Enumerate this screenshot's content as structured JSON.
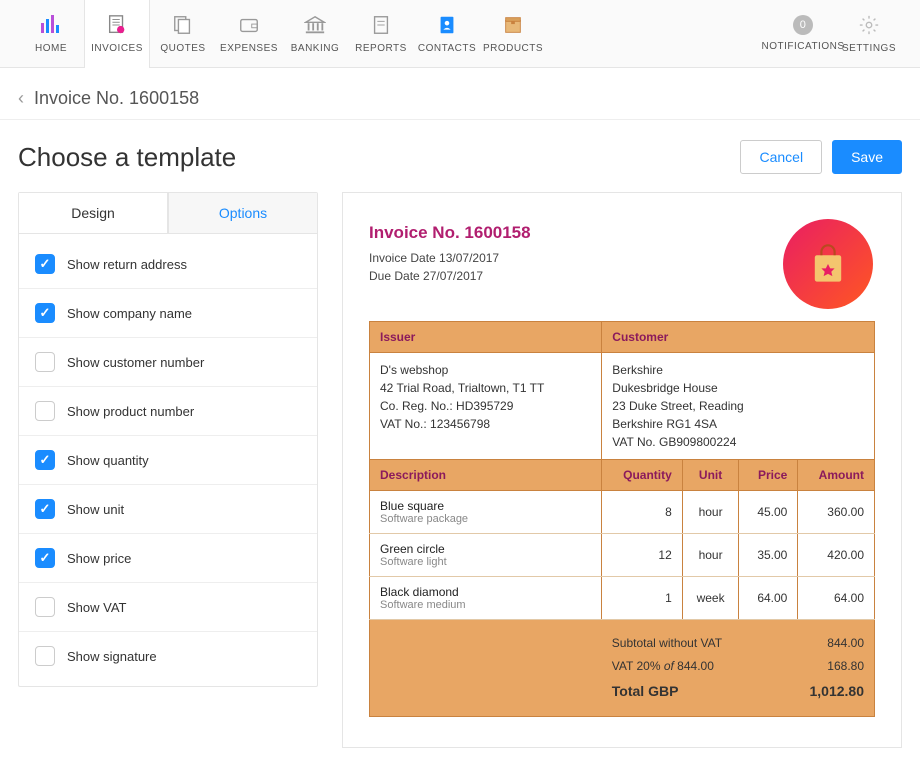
{
  "nav": {
    "items": [
      {
        "label": "HOME"
      },
      {
        "label": "INVOICES"
      },
      {
        "label": "QUOTES"
      },
      {
        "label": "EXPENSES"
      },
      {
        "label": "BANKING"
      },
      {
        "label": "REPORTS"
      },
      {
        "label": "CONTACTS"
      },
      {
        "label": "PRODUCTS"
      }
    ],
    "notifications_label": "NOTIFICATIONS",
    "notifications_count": "0",
    "settings_label": "SETTINGS"
  },
  "breadcrumb": "Invoice No. 1600158",
  "page_title": "Choose a template",
  "buttons": {
    "cancel": "Cancel",
    "save": "Save"
  },
  "tabs": {
    "design": "Design",
    "options": "Options"
  },
  "options": [
    {
      "label": "Show return address",
      "checked": true
    },
    {
      "label": "Show company name",
      "checked": true
    },
    {
      "label": "Show customer number",
      "checked": false
    },
    {
      "label": "Show product number",
      "checked": false
    },
    {
      "label": "Show quantity",
      "checked": true
    },
    {
      "label": "Show unit",
      "checked": true
    },
    {
      "label": "Show price",
      "checked": true
    },
    {
      "label": "Show VAT",
      "checked": false
    },
    {
      "label": "Show signature",
      "checked": false
    }
  ],
  "invoice": {
    "title": "Invoice No. 1600158",
    "date_label": "Invoice Date 13/07/2017",
    "due_label": "Due Date 27/07/2017",
    "issuer_header": "Issuer",
    "customer_header": "Customer",
    "issuer": [
      "D's webshop",
      "42 Trial Road, Trialtown, T1 TT",
      "Co. Reg. No.: HD395729",
      "VAT No.: 123456798"
    ],
    "customer": [
      "Berkshire",
      "Dukesbridge House",
      "23 Duke Street, Reading",
      "Berkshire RG1 4SA",
      "VAT No. GB909800224"
    ],
    "cols": {
      "desc": "Description",
      "qty": "Quantity",
      "unit": "Unit",
      "price": "Price",
      "amount": "Amount"
    },
    "items": [
      {
        "name": "Blue square",
        "sub": "Software package",
        "qty": "8",
        "unit": "hour",
        "price": "45.00",
        "amount": "360.00"
      },
      {
        "name": "Green circle",
        "sub": "Software light",
        "qty": "12",
        "unit": "hour",
        "price": "35.00",
        "amount": "420.00"
      },
      {
        "name": "Black diamond",
        "sub": "Software medium",
        "qty": "1",
        "unit": "week",
        "price": "64.00",
        "amount": "64.00"
      }
    ],
    "totals": {
      "subtotal_label": "Subtotal without VAT",
      "subtotal": "844.00",
      "vat_label_a": "VAT 20% ",
      "vat_label_i": "of ",
      "vat_label_b": "844.00",
      "vat": "168.80",
      "grand_label": "Total GBP",
      "grand": "1,012.80"
    }
  }
}
